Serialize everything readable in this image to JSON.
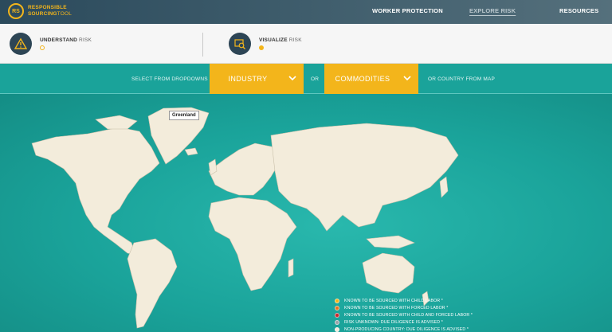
{
  "header": {
    "logo_mark": "RS",
    "logo_line1": "RESPONSIBLE",
    "logo_line2_bold": "SOURCING",
    "logo_line2_thin": "TOOL",
    "nav": [
      {
        "label": "WORKER PROTECTION",
        "active": false
      },
      {
        "label": "EXPLORE RISK",
        "active": true
      },
      {
        "label": "RESOURCES",
        "active": false
      }
    ]
  },
  "steps": [
    {
      "bold": "UNDERSTAND",
      "light": "RISK",
      "icon": "warning-icon",
      "dot_color": "#f3b51b",
      "dot_filled": false
    },
    {
      "bold": "VISUALIZE",
      "light": "RISK",
      "icon": "map-search-icon",
      "dot_color": "#f3b51b",
      "dot_filled": true
    }
  ],
  "filters": {
    "prompt": "SELECT FROM DROPDOWNS",
    "industry_label": "INDUSTRY",
    "or_label": "OR",
    "commodities_label": "COMMODITIES",
    "country_text": "OR COUNTRY FROM MAP",
    "accent_color": "#f3b51b"
  },
  "map": {
    "tooltip": "Greenland",
    "land_color": "#f3ecdb",
    "sea_color": "#1aa39a"
  },
  "legend": [
    {
      "label": "KNOWN TO BE SOURCED WITH CHILD LABOR *",
      "color": "#f3b51b"
    },
    {
      "label": "KNOWN TO BE SOURCED WITH FORCED LABOR *",
      "color": "#e8731d"
    },
    {
      "label": "KNOWN TO BE SOURCED WITH CHILD AND FORCED LABOR *",
      "color": "#c8262b"
    },
    {
      "label": "RISK UNKNOWN: DUE DILIGENCE IS ADVISED *",
      "color": "#9aa3a8"
    },
    {
      "label": "NON-PRODUCING COUNTRY: DUE DILIGENCE IS ADVISED *",
      "color": "#f3ecdb"
    }
  ]
}
